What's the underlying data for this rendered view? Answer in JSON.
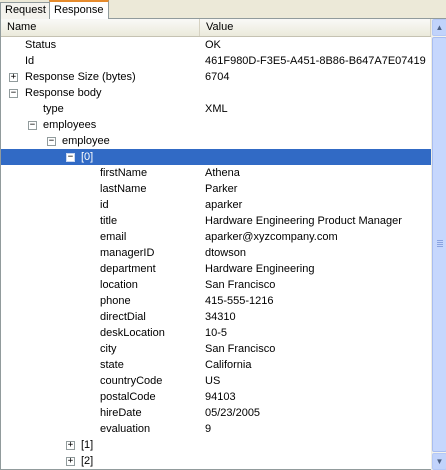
{
  "tabs": [
    {
      "label": "Request"
    },
    {
      "label": "Response"
    }
  ],
  "columns": {
    "name": "Name",
    "value": "Value"
  },
  "rows": [
    {
      "name": "Status",
      "value": "OK",
      "toggle": ""
    },
    {
      "name": "Id",
      "value": "461F980D-F3E5-A451-8B86-B647A7E07419",
      "toggle": ""
    },
    {
      "name": "Response Size (bytes)",
      "value": "6704",
      "toggle": "+"
    },
    {
      "name": "Response body",
      "value": "",
      "toggle": "−"
    },
    {
      "name": "type",
      "value": "XML",
      "toggle": ""
    },
    {
      "name": "employees",
      "value": "",
      "toggle": "−"
    },
    {
      "name": "employee",
      "value": "",
      "toggle": "−"
    },
    {
      "name": "[0]",
      "value": "",
      "toggle": "−"
    },
    {
      "name": "firstName",
      "value": "Athena",
      "toggle": ""
    },
    {
      "name": "lastName",
      "value": "Parker",
      "toggle": ""
    },
    {
      "name": "id",
      "value": "aparker",
      "toggle": ""
    },
    {
      "name": "title",
      "value": "Hardware Engineering Product Manager",
      "toggle": ""
    },
    {
      "name": "email",
      "value": "aparker@xyzcompany.com",
      "toggle": ""
    },
    {
      "name": "managerID",
      "value": "dtowson",
      "toggle": ""
    },
    {
      "name": "department",
      "value": "Hardware Engineering",
      "toggle": ""
    },
    {
      "name": "location",
      "value": "San Francisco",
      "toggle": ""
    },
    {
      "name": "phone",
      "value": "415-555-1216",
      "toggle": ""
    },
    {
      "name": "directDial",
      "value": "34310",
      "toggle": ""
    },
    {
      "name": "deskLocation",
      "value": "10-5",
      "toggle": ""
    },
    {
      "name": "city",
      "value": "San Francisco",
      "toggle": ""
    },
    {
      "name": "state",
      "value": "California",
      "toggle": ""
    },
    {
      "name": "countryCode",
      "value": "US",
      "toggle": ""
    },
    {
      "name": "postalCode",
      "value": "94103",
      "toggle": ""
    },
    {
      "name": "hireDate",
      "value": "05/23/2005",
      "toggle": ""
    },
    {
      "name": "evaluation",
      "value": "9",
      "toggle": ""
    },
    {
      "name": "[1]",
      "value": "",
      "toggle": "+"
    },
    {
      "name": "[2]",
      "value": "",
      "toggle": "+"
    }
  ],
  "scrollbar": {
    "up_icon": "▲",
    "down_icon": "▼"
  },
  "colors": {
    "selection": "#316ac5",
    "active_tab_accent": "#e68b2c"
  }
}
